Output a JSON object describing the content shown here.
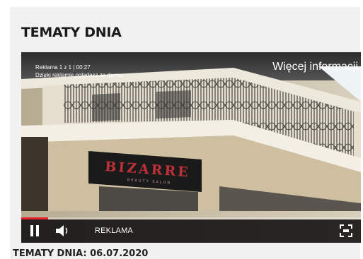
{
  "section": {
    "title": "TEMATY DNIA"
  },
  "ad": {
    "counter": "Reklama 1 z 1 | 00:27",
    "note": "Dzięki reklamie oglądasz za darmo",
    "more_info_label": "Więcej informacji",
    "controls_label": "REKLAMA",
    "progress": 0.08,
    "progress_color": "#e8202a",
    "sign_text": "BIZARRE",
    "sign_subtext": "BEAUTY SALON"
  },
  "icons": {
    "pause": "pause-icon",
    "volume": "volume-icon",
    "fullscreen": "fullscreen-icon"
  },
  "article": {
    "title": "TEMATY DNIA: 06.07.2020"
  }
}
